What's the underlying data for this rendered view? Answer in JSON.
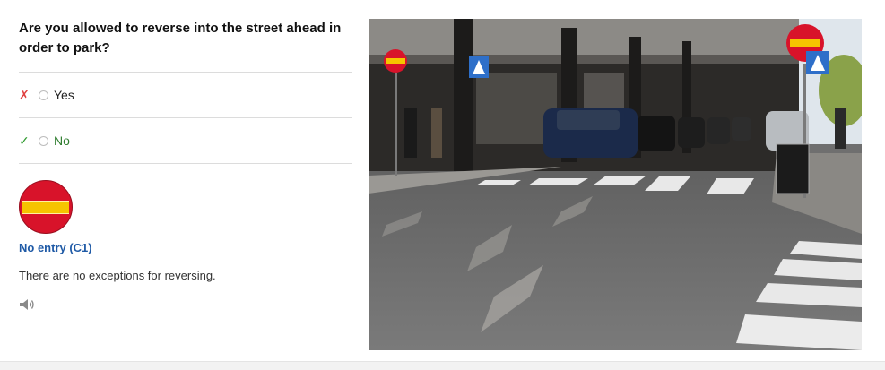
{
  "question": "Are you allowed to reverse into the street ahead in order to park?",
  "answers": [
    {
      "label": "Yes",
      "mark": "✗",
      "status": "incorrect"
    },
    {
      "label": "No",
      "mark": "✓",
      "status": "correct"
    }
  ],
  "sign": {
    "icon": "no-entry-sign-icon",
    "title": "No entry (C1)"
  },
  "explanation": "There are no exceptions for reversing.",
  "audio": {
    "icon": "speaker-icon"
  },
  "colors": {
    "sign_red": "#d8132a",
    "sign_yellow": "#f6c400",
    "title_blue": "#1f5aa6",
    "correct_green": "#2f9a2f",
    "wrong_red": "#e04040"
  }
}
